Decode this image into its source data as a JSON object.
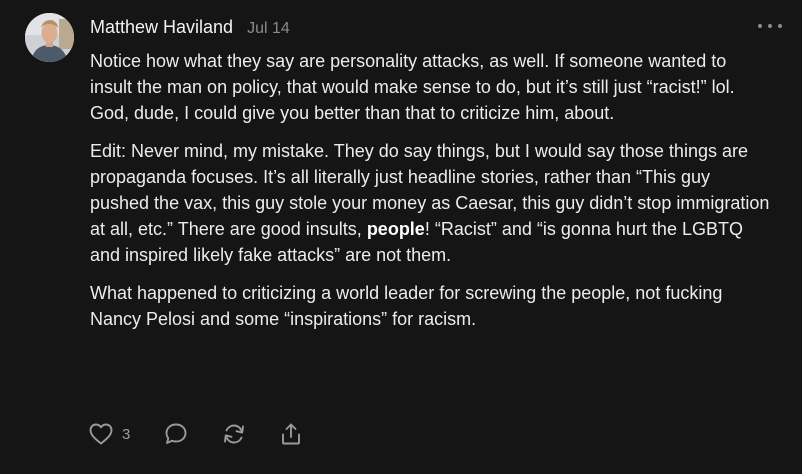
{
  "comment": {
    "author": "Matthew Haviland",
    "date": "Jul 14",
    "paragraphs": {
      "p1": "Notice how what they say are personality attacks, as well. If someone wanted to insult the man on policy, that would make sense to do, but it’s still just “racist!” lol. God, dude, I could give you better than that to criticize him, about.",
      "p2_before": "Edit: Never mind, my mistake. They do say things, but I would say those things are propaganda focuses. It’s all literally just headline stories, rather than “This guy pushed the vax, this guy stole your money as Caesar, this guy didn’t stop immigration at all, etc.” There are good insults, ",
      "p2_bold": "people",
      "p2_after": "! “Racist” and “is gonna hurt the LGBTQ and inspired likely fake attacks” are not them.",
      "p3": "What happened to criticizing a world leader for screwing the people, not fucking Nancy Pelosi and some “inspirations” for racism."
    },
    "like_count": "3"
  },
  "icons": {
    "more": "more-options-icon",
    "like": "heart-icon",
    "reply": "comment-bubble-icon",
    "restack": "restack-icon",
    "share": "share-icon"
  },
  "colors": {
    "background": "#151515",
    "text": "#ececec",
    "muted": "#8a8a8a"
  }
}
